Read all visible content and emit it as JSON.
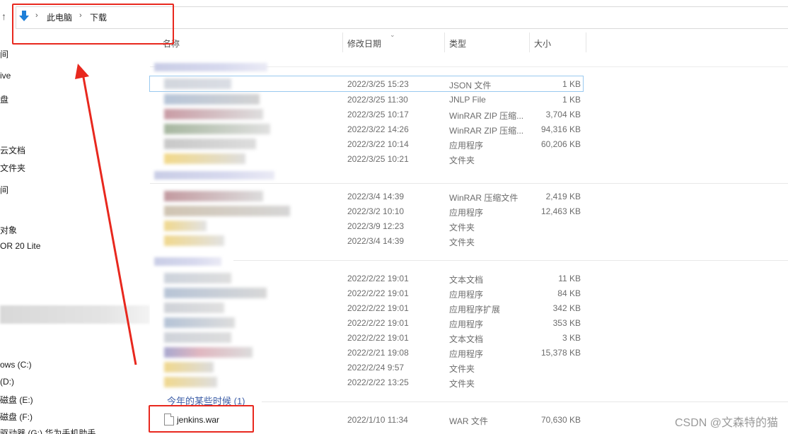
{
  "address_bar": {
    "crumbs": [
      "此电脑",
      "下载"
    ],
    "separator": "›",
    "up_glyph": "↑"
  },
  "nav_pane": {
    "items": [
      "间",
      "ive",
      "盘",
      "云文档",
      "文件夹",
      "间",
      "对象",
      "OR 20 Lite",
      "ows (C:)",
      "(D:)",
      "磁盘 (E:)",
      "磁盘 (F:)",
      "驱动器 (G:) 华为手机助手"
    ]
  },
  "columns": {
    "name": "名称",
    "date": "修改日期",
    "type": "类型",
    "size": "大小",
    "sort_glyph": "⌄"
  },
  "groups": [
    {
      "rows": [
        {
          "date": "2022/3/25 15:23",
          "type": "JSON 文件",
          "size": "1 KB"
        },
        {
          "date": "2022/3/25 11:30",
          "type": "JNLP File",
          "size": "1 KB"
        },
        {
          "date": "2022/3/25 10:17",
          "type": "WinRAR ZIP 压缩...",
          "size": "3,704 KB"
        },
        {
          "date": "2022/3/22 14:26",
          "type": "WinRAR ZIP 压缩...",
          "size": "94,316 KB"
        },
        {
          "date": "2022/3/22 10:14",
          "type": "应用程序",
          "size": "60,206 KB"
        },
        {
          "date": "2022/3/25 10:21",
          "type": "文件夹",
          "size": ""
        }
      ]
    },
    {
      "rows": [
        {
          "date": "2022/3/4 14:39",
          "type": "WinRAR 压缩文件",
          "size": "2,419 KB"
        },
        {
          "date": "2022/3/2 10:10",
          "type": "应用程序",
          "size": "12,463 KB"
        },
        {
          "date": "2022/3/9 12:23",
          "type": "文件夹",
          "size": ""
        },
        {
          "date": "2022/3/4 14:39",
          "type": "文件夹",
          "size": ""
        }
      ]
    },
    {
      "rows": [
        {
          "date": "2022/2/22 19:01",
          "type": "文本文档",
          "size": "11 KB"
        },
        {
          "date": "2022/2/22 19:01",
          "type": "应用程序",
          "size": "84 KB"
        },
        {
          "date": "2022/2/22 19:01",
          "type": "应用程序扩展",
          "size": "342 KB"
        },
        {
          "date": "2022/2/22 19:01",
          "type": "应用程序",
          "size": "353 KB"
        },
        {
          "date": "2022/2/22 19:01",
          "type": "文本文档",
          "size": "3 KB"
        },
        {
          "date": "2022/2/21 19:08",
          "type": "应用程序",
          "size": "15,378 KB"
        },
        {
          "date": "2022/2/24 9:57",
          "type": "文件夹",
          "size": ""
        },
        {
          "date": "2022/2/22 13:25",
          "type": "文件夹",
          "size": ""
        }
      ]
    },
    {
      "label": "今年的某些时候 (1)",
      "rows": [
        {
          "name": "jenkins.war",
          "date": "2022/1/10 11:34",
          "type": "WAR 文件",
          "size": "70,630 KB"
        }
      ]
    }
  ],
  "watermark": "CSDN @文森特的猫",
  "colors": {
    "annotation_red": "#e8281e",
    "group_label_blue": "#3e5fa8",
    "download_arrow_blue": "#1e7fd8"
  }
}
